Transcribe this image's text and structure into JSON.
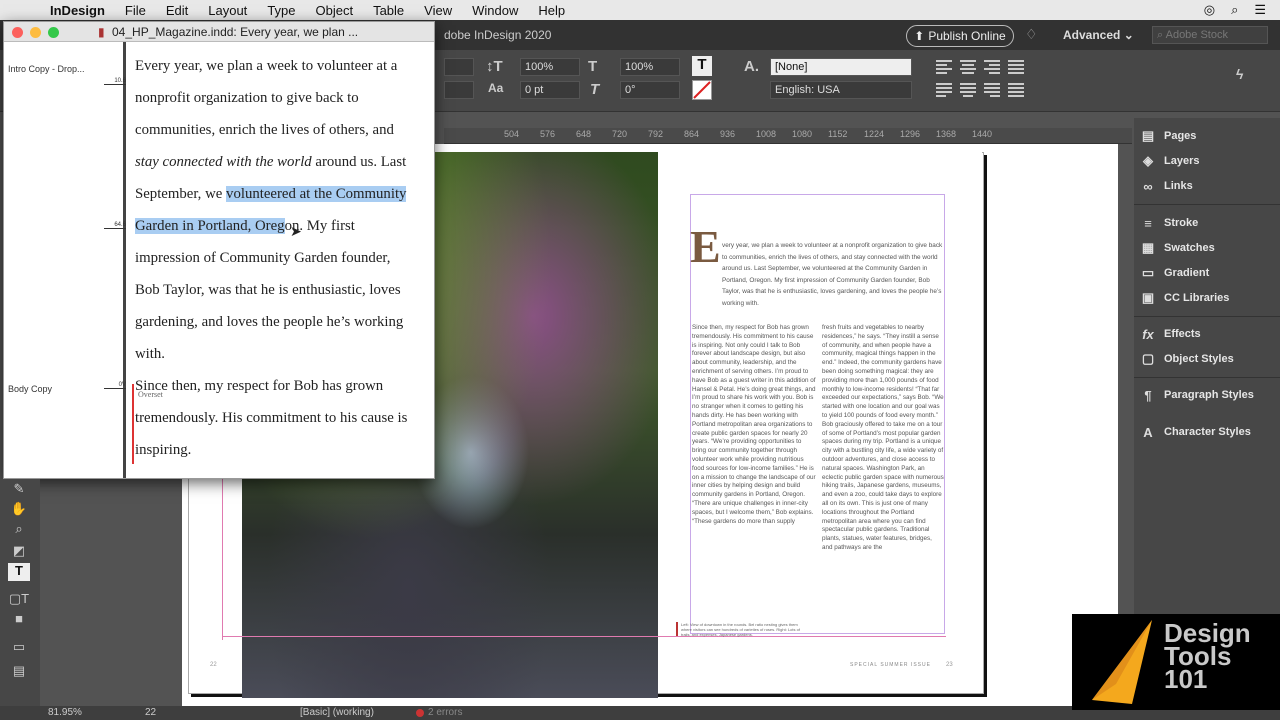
{
  "menubar": {
    "apple": "",
    "app": "InDesign",
    "items": [
      "File",
      "Edit",
      "Layout",
      "Type",
      "Object",
      "Table",
      "View",
      "Window",
      "Help"
    ]
  },
  "appbar": {
    "doc_title": "dobe InDesign 2020",
    "publish": "Publish Online",
    "workspace": "Advanced",
    "stock_placeholder": "Adobe Stock"
  },
  "control": {
    "scale_v": "100%",
    "scale_h": "100%",
    "tracking": "0 pt",
    "skew": "0°",
    "char_style": "[None]",
    "language": "English: USA"
  },
  "ruler": {
    "ticks": [
      "504",
      "576",
      "648",
      "720",
      "792",
      "864",
      "936",
      "1008",
      "1080",
      "1152",
      "1224",
      "1296",
      "1368",
      "1440"
    ]
  },
  "story": {
    "window_title": "04_HP_Magazine.indd: Every year, we plan ...",
    "styles": [
      {
        "label": "Intro Copy - Drop...",
        "depth": "10.6"
      },
      {
        "label": "",
        "depth": "64.6"
      },
      {
        "label": "Body Copy",
        "depth": "0V"
      }
    ],
    "overset_label": "Overset",
    "lines": [
      "Every year, we plan a week to volunteer at a",
      "nonprofit organization to give back to",
      "communities, enrich the lives of others, and"
    ],
    "line4_italic": "stay connected with the world",
    "line4_rest": " around us.  Last",
    "line5_pre": "September, we ",
    "line5_sel": "volunteered at the Community",
    "line6_sel": "Garden in Portland, Oreg",
    "line6_sel2": "on",
    "line6_rest": ". My first",
    "lines_after": [
      "impression of Community Garden founder,",
      "Bob Taylor, was that he is enthusiastic, loves",
      "gardening, and loves the people he’s working",
      "with."
    ],
    "body_lines": [
      "Since then, my respect for Bob has grown",
      "tremendously. His commitment to his cause is",
      "inspiring."
    ]
  },
  "layout": {
    "dropcap": "E",
    "intro": "very year, we plan a week to volunteer at a nonprofit organization to give back to communities, enrich the lives of others, and stay connected with the world around us.  Last September, we volunteered at the Community Garden in Portland, Oregon. My first impression of Community Garden founder, Bob Taylor, was that he is enthusiastic, loves gardening, and loves the people he’s working with.",
    "col1": "Since then, my respect for Bob has grown tremendously. His commitment to his cause is inspiring.  Not only could I talk to Bob forever about landscape design, but also about community, leadership, and the enrichment of serving others. I’m proud to have Bob as a guest writer in this addition of Hansel & Petal. He’s doing great things, and I’m proud to share his work with you.  Bob is no stranger when it comes to getting his hands dirty. He has been working with Portland metropolitan area organizations to create public garden spaces for nearly 20 years. “We’re providing opportunities to bring our community together through volunteer work while providing nutritious food sources for low-income families.”  He is on a mission to change the landscape of our inner cities by helping design and build community gardens in Portland, Oregon. “There are unique challenges in inner-city spaces, but I welcome them,” Bob explains. “These gardens do more than supply",
    "col2": "fresh fruits and vegetables to nearby residences,” he says. “They instill a sense of community, and when people have a community, magical things happen in the end.” Indeed, the community gardens have been doing something magical: they are providing more than 1,000 pounds of food monthly to low-income residents! “That far exceeded our expectations,” says Bob. “We started with one location and our goal was to yield 100 pounds of food every month.”  Bob graciously offered to take me on a tour of some of Portland’s most popular garden spaces during my trip. Portland is a unique city with a bustling city life, a wide variety of outdoor adventures, and close access to natural spaces. Washington Park, an eclectic public garden space with numerous hiking trails, Japanese gardens, museums, and even a zoo, could take days to explore all on its own. This is just one of many locations throughout the Portland metropolitan area where you can find spectacular public gardens.  Traditional plants, statues, water features, bridges, and pathways are the",
    "caption": "Left: View of downtown in the rounds. Bel ratio nesting gives them where visitors can see hundreds of varieties of roses. Right: Lots of trails, and expenses, Japanese gardens.",
    "footer": "SPECIAL SUMMER ISSUE",
    "page_left": "22",
    "page_right": "23"
  },
  "panels": [
    {
      "label": "Pages",
      "icon": "pages-icon",
      "glyph": "▤"
    },
    {
      "label": "Layers",
      "icon": "layers-icon",
      "glyph": "◈"
    },
    {
      "label": "Links",
      "icon": "links-icon",
      "glyph": "∞"
    },
    {
      "label": "Stroke",
      "icon": "stroke-icon",
      "glyph": "≡"
    },
    {
      "label": "Swatches",
      "icon": "swatches-icon",
      "glyph": "▦"
    },
    {
      "label": "Gradient",
      "icon": "gradient-icon",
      "glyph": "▭"
    },
    {
      "label": "CC Libraries",
      "icon": "cc-libraries-icon",
      "glyph": "▣"
    },
    {
      "label": "Effects",
      "icon": "effects-icon",
      "glyph": "fx"
    },
    {
      "label": "Object Styles",
      "icon": "object-styles-icon",
      "glyph": "▢"
    },
    {
      "label": "Paragraph Styles",
      "icon": "paragraph-styles-icon",
      "glyph": "¶"
    },
    {
      "label": "Character Styles",
      "icon": "character-styles-icon",
      "glyph": "A"
    }
  ],
  "status": {
    "zoom": "81.95%",
    "page": "22",
    "style": "[Basic] (working)",
    "errors": "2 errors"
  },
  "logo": {
    "line1": "Design",
    "line2": "Tools",
    "line3": "101"
  }
}
